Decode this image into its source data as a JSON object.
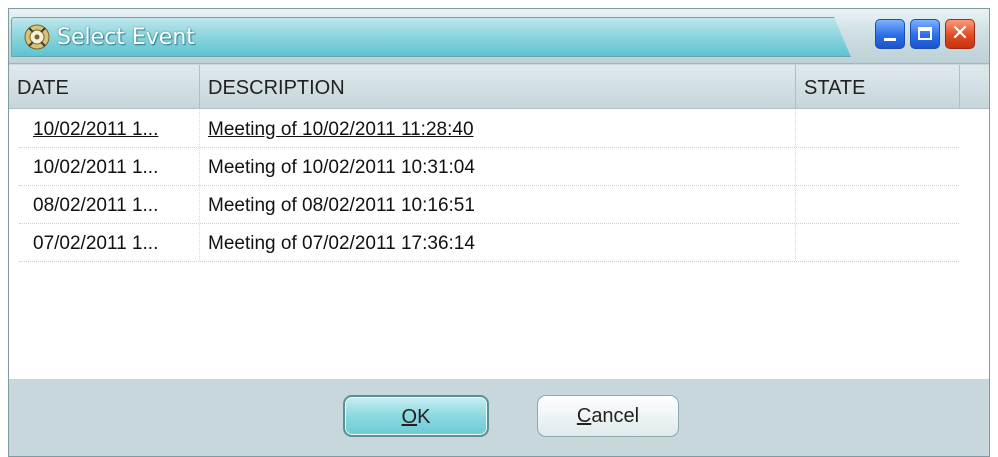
{
  "window": {
    "title": "Select Event",
    "icon": "cd-gear-icon"
  },
  "list": {
    "columns": [
      {
        "label": "DATE"
      },
      {
        "label": "DESCRIPTION"
      },
      {
        "label": "STATE"
      }
    ],
    "rows": [
      {
        "date": "10/02/2011 1...",
        "description": "Meeting of 10/02/2011 11:28:40",
        "state": ""
      },
      {
        "date": "10/02/2011 1...",
        "description": "Meeting of 10/02/2011 10:31:04",
        "state": ""
      },
      {
        "date": "08/02/2011 1...",
        "description": "Meeting of 08/02/2011 10:16:51",
        "state": ""
      },
      {
        "date": "07/02/2011 1...",
        "description": "Meeting of 07/02/2011 17:36:14",
        "state": ""
      }
    ]
  },
  "buttons": {
    "ok": {
      "accel": "O",
      "rest": "K"
    },
    "cancel": {
      "accel": "C",
      "rest": "ancel"
    }
  },
  "colors": {
    "title_accent": "#5ec3cf",
    "ok_button": "#8bd8e0",
    "close_button": "#e24a23",
    "min_max_button": "#2a6ee8"
  }
}
